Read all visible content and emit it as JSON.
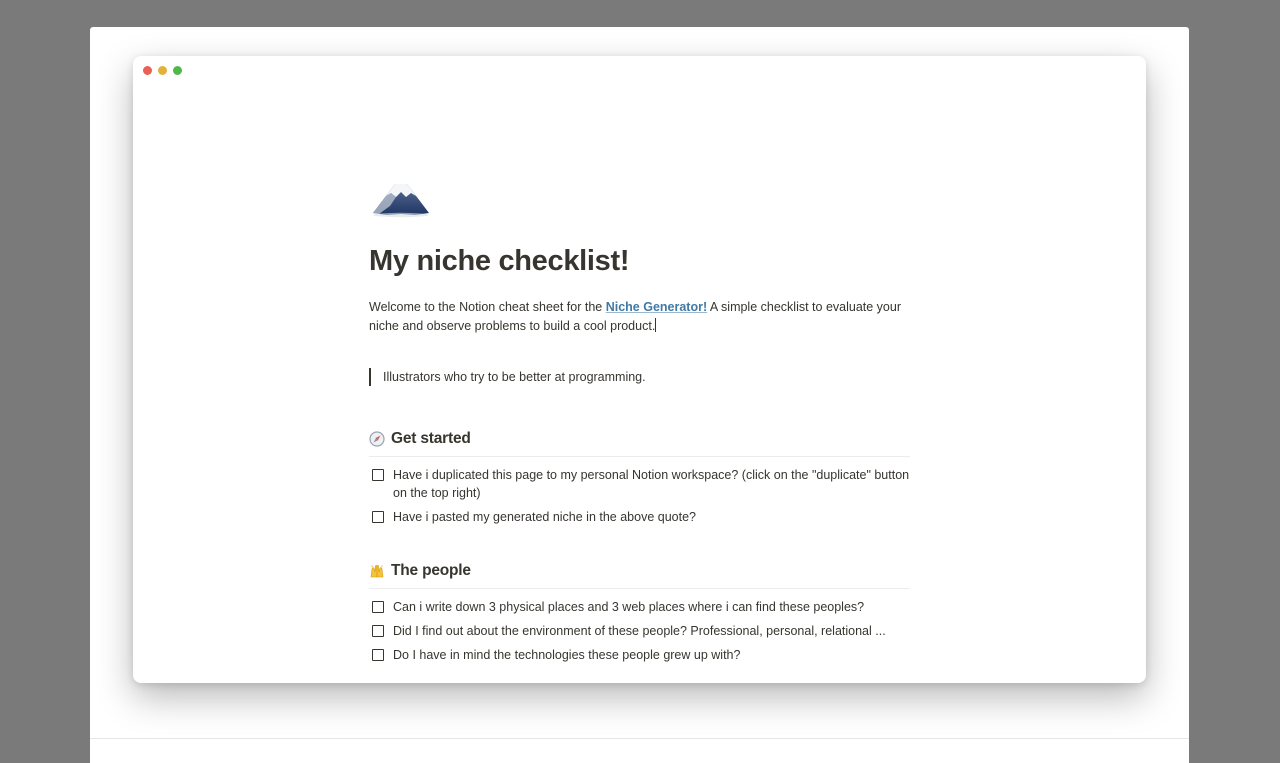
{
  "page": {
    "title": "My niche checklist!",
    "icon": "mount-fuji-icon",
    "intro": {
      "before_link": "Welcome to the Notion cheat sheet for the ",
      "link_text": "Niche Generator!",
      "after_link": " A simple checklist to evaluate your niche and observe problems to build a cool product."
    },
    "quote": "Illustrators who try to be better at programming."
  },
  "window_controls": {
    "close_color": "#ec5f57",
    "minimize_color": "#e3b03c",
    "maximize_color": "#4fb848"
  },
  "sections": [
    {
      "icon": "compass-icon",
      "title": "Get started",
      "items": [
        {
          "text": "Have i duplicated this page to my personal Notion workspace? (click on the \"duplicate\" button on the top right)",
          "checked": false
        },
        {
          "text": "Have i pasted my generated niche in the above quote?",
          "checked": false
        }
      ]
    },
    {
      "icon": "raising-hands-icon",
      "title": "The people",
      "items": [
        {
          "text": "Can i write down 3 physical places and 3 web places where i can find these peoples?",
          "checked": false
        },
        {
          "text": "Did I find out about the environment of these people? Professional, personal, relational ...",
          "checked": false
        },
        {
          "text": "Do I have in mind the technologies these people grew up with?",
          "checked": false
        }
      ]
    }
  ],
  "colors": {
    "text": "#37352f",
    "link": "#3f7aa6",
    "backdrop": "#7a7a7a"
  }
}
